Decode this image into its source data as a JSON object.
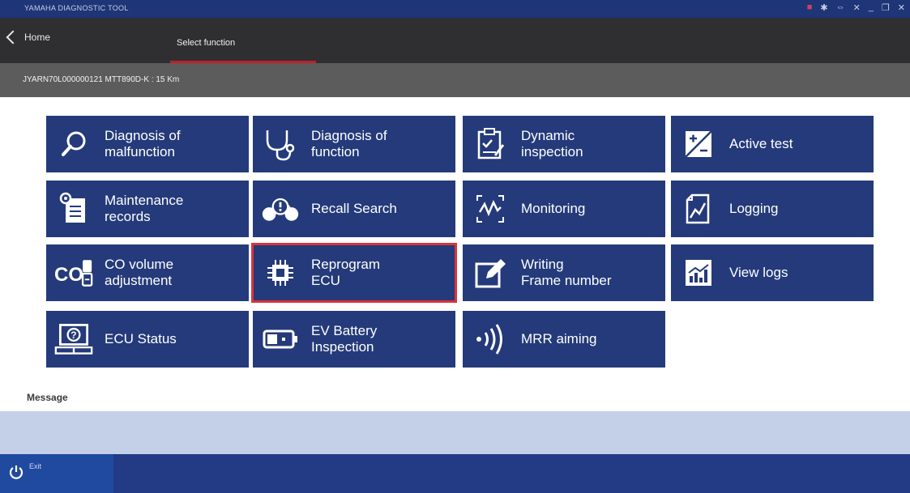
{
  "window": {
    "title": "YAMAHA DIAGNOSTIC TOOL",
    "controls": [
      "■",
      "✱",
      "⇔",
      "✕",
      "_",
      "❐",
      "✕"
    ]
  },
  "nav": {
    "home_label": "Home",
    "active_tab": "Select function"
  },
  "vehicle": {
    "info": "JYARN70L000000121 MTT890D-K : 15 Km"
  },
  "functions": [
    {
      "label": "Diagnosis of\nmalfunction",
      "icon": "magnifier-icon"
    },
    {
      "label": "Diagnosis of\nfunction",
      "icon": "stethoscope-icon"
    },
    {
      "label": "Dynamic\ninspection",
      "icon": "clipboard-check-icon"
    },
    {
      "label": "Active test",
      "icon": "plus-minus-icon"
    },
    {
      "label": "Maintenance\nrecords",
      "icon": "maintenance-records-icon"
    },
    {
      "label": "Recall Search",
      "icon": "motorcycle-alert-icon"
    },
    {
      "label": "Monitoring",
      "icon": "waveform-icon"
    },
    {
      "label": "Logging",
      "icon": "log-graph-icon"
    },
    {
      "label": "CO volume\nadjustment",
      "icon": "co-adjust-icon"
    },
    {
      "label": "Reprogram\nECU",
      "icon": "chip-icon"
    },
    {
      "label": "Writing\nFrame number",
      "icon": "edit-box-icon"
    },
    {
      "label": "View logs",
      "icon": "bar-chart-icon"
    },
    {
      "label": "ECU Status",
      "icon": "ecu-status-icon"
    },
    {
      "label": "EV Battery\nInspection",
      "icon": "battery-icon"
    },
    {
      "label": "MRR aiming",
      "icon": "radar-signal-icon"
    }
  ],
  "selected_function": "Reprogram\nECU",
  "message": {
    "label": "Message",
    "text": ""
  },
  "footer": {
    "exit_label": "Exit"
  },
  "colors": {
    "tile": "#243a7a",
    "selection": "#d8343a",
    "titlebar": "#1e3577",
    "footer": "#233a85"
  }
}
